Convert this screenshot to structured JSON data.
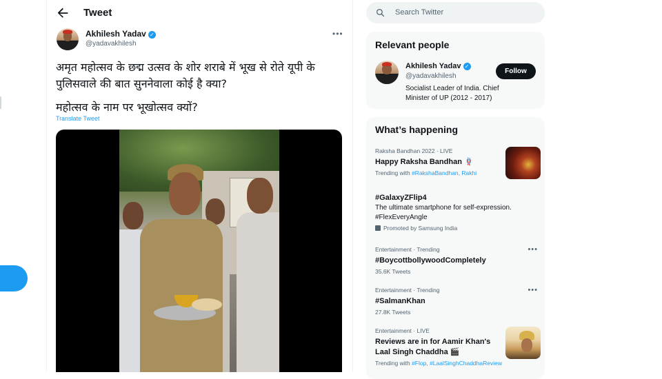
{
  "header": {
    "title": "Tweet"
  },
  "tweet": {
    "author_name": "Akhilesh Yadav",
    "author_handle": "@yadavakhilesh",
    "text_line1": "अमृत महोत्सव के छद्म उत्सव के शोर शराबे में भूख से रोते यूपी के पुलिसवाले की बात सुननेवाला कोई है क्या?",
    "text_line2": "महोत्सव के नाम पर भूखोत्सव क्यों?",
    "translate_label": "Translate Tweet"
  },
  "search": {
    "placeholder": "Search Twitter"
  },
  "relevant_people": {
    "title": "Relevant people",
    "name": "Akhilesh Yadav",
    "handle": "@yadavakhilesh",
    "bio": "Socialist Leader of India. Chief Minister of UP (2012 - 2017)",
    "follow_label": "Follow"
  },
  "whats_happening": {
    "title": "What’s happening",
    "trends": [
      {
        "meta": "Raksha Bandhan 2022 · LIVE",
        "title": "Happy Raksha Bandhan 🪢",
        "sub_prefix": "Trending with ",
        "sub_links": "#RakshaBandhan, Rakhi"
      },
      {
        "title": "#GalaxyZFlip4",
        "desc": "The ultimate smartphone for self-expression. #FlexEveryAngle",
        "promo": "Promoted by Samsung India"
      },
      {
        "meta": "Entertainment · Trending",
        "title": "#BoycottbollywoodCompletely",
        "count": "35.6K Tweets"
      },
      {
        "meta": "Entertainment · Trending",
        "title": "#SalmanKhan",
        "count": "27.8K Tweets"
      },
      {
        "meta": "Entertainment · LIVE",
        "title": "Reviews are in for Aamir Khan's Laal Singh Chaddha 🎬",
        "sub_prefix": "Trending with ",
        "sub_links": "#Flop, #LaalSinghChaddhaReview"
      }
    ]
  },
  "colors": {
    "accent": "#1d9bf0",
    "text": "#0f1419",
    "muted": "#536471",
    "card": "#f7f9f9"
  },
  "icons": {
    "back": "back-arrow-icon",
    "search": "search-icon",
    "verified": "verified-badge-icon",
    "more": "more-icon"
  }
}
